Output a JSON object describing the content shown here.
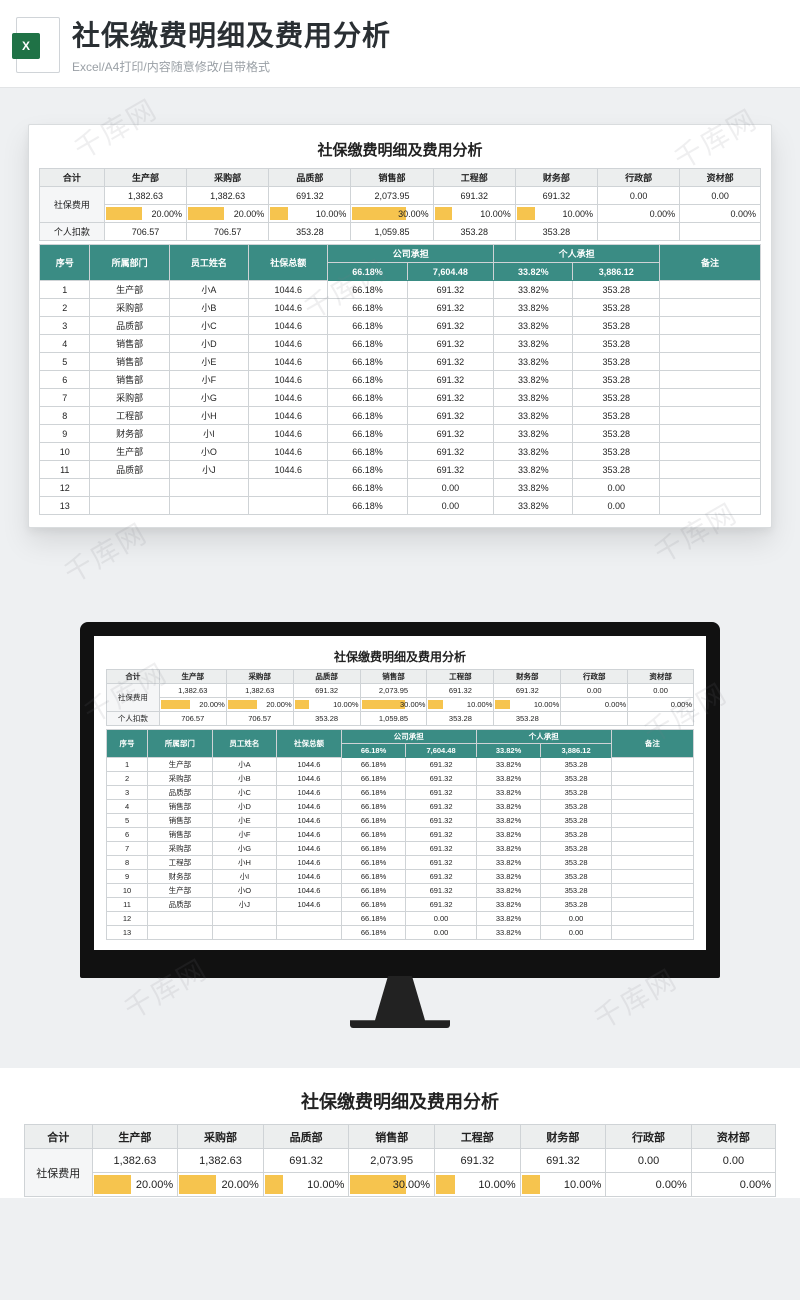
{
  "banner": {
    "title": "社保缴费明细及费用分析",
    "subtitle": "Excel/A4打印/内容随意修改/自带格式",
    "icon_label": "X",
    "icon_alt": "excel-icon"
  },
  "watermark_text": "千库网",
  "sheet_title": "社保缴费明细及费用分析",
  "summary": {
    "row_labels": {
      "total": "合计",
      "fee": "社保费用",
      "personal": "个人扣款"
    },
    "departments": [
      "生产部",
      "采购部",
      "品质部",
      "销售部",
      "工程部",
      "财务部",
      "行政部",
      "资材部"
    ],
    "fee_values": [
      "1,382.63",
      "1,382.63",
      "691.32",
      "2,073.95",
      "691.32",
      "691.32",
      "0.00",
      "0.00"
    ],
    "fee_pcts": [
      "20.00%",
      "20.00%",
      "10.00%",
      "30.00%",
      "10.00%",
      "10.00%",
      "0.00%",
      "0.00%"
    ],
    "fee_pcts_num": [
      20,
      20,
      10,
      30,
      10,
      10,
      0,
      0
    ],
    "personal_values": [
      "706.57",
      "706.57",
      "353.28",
      "1,059.85",
      "353.28",
      "353.28",
      "",
      ""
    ]
  },
  "detail": {
    "headers": {
      "seq": "序号",
      "dept": "所属部门",
      "name": "员工姓名",
      "total": "社保总额",
      "corp": "公司承担",
      "pers": "个人承担",
      "remark": "备注"
    },
    "sub_totals": {
      "corp_pct": "66.18%",
      "corp_amt": "7,604.48",
      "pers_pct": "33.82%",
      "pers_amt": "3,886.12"
    },
    "rows": [
      {
        "seq": "1",
        "dept": "生产部",
        "name": "小A",
        "total": "1044.6",
        "cp": "66.18%",
        "ca": "691.32",
        "pp": "33.82%",
        "pa": "353.28"
      },
      {
        "seq": "2",
        "dept": "采购部",
        "name": "小B",
        "total": "1044.6",
        "cp": "66.18%",
        "ca": "691.32",
        "pp": "33.82%",
        "pa": "353.28"
      },
      {
        "seq": "3",
        "dept": "品质部",
        "name": "小C",
        "total": "1044.6",
        "cp": "66.18%",
        "ca": "691.32",
        "pp": "33.82%",
        "pa": "353.28"
      },
      {
        "seq": "4",
        "dept": "销售部",
        "name": "小D",
        "total": "1044.6",
        "cp": "66.18%",
        "ca": "691.32",
        "pp": "33.82%",
        "pa": "353.28"
      },
      {
        "seq": "5",
        "dept": "销售部",
        "name": "小E",
        "total": "1044.6",
        "cp": "66.18%",
        "ca": "691.32",
        "pp": "33.82%",
        "pa": "353.28"
      },
      {
        "seq": "6",
        "dept": "销售部",
        "name": "小F",
        "total": "1044.6",
        "cp": "66.18%",
        "ca": "691.32",
        "pp": "33.82%",
        "pa": "353.28"
      },
      {
        "seq": "7",
        "dept": "采购部",
        "name": "小G",
        "total": "1044.6",
        "cp": "66.18%",
        "ca": "691.32",
        "pp": "33.82%",
        "pa": "353.28"
      },
      {
        "seq": "8",
        "dept": "工程部",
        "name": "小H",
        "total": "1044.6",
        "cp": "66.18%",
        "ca": "691.32",
        "pp": "33.82%",
        "pa": "353.28"
      },
      {
        "seq": "9",
        "dept": "财务部",
        "name": "小I",
        "total": "1044.6",
        "cp": "66.18%",
        "ca": "691.32",
        "pp": "33.82%",
        "pa": "353.28"
      },
      {
        "seq": "10",
        "dept": "生产部",
        "name": "小O",
        "total": "1044.6",
        "cp": "66.18%",
        "ca": "691.32",
        "pp": "33.82%",
        "pa": "353.28"
      },
      {
        "seq": "11",
        "dept": "品质部",
        "name": "小J",
        "total": "1044.6",
        "cp": "66.18%",
        "ca": "691.32",
        "pp": "33.82%",
        "pa": "353.28"
      },
      {
        "seq": "12",
        "dept": "",
        "name": "",
        "total": "",
        "cp": "66.18%",
        "ca": "0.00",
        "pp": "33.82%",
        "pa": "0.00"
      },
      {
        "seq": "13",
        "dept": "",
        "name": "",
        "total": "",
        "cp": "66.18%",
        "ca": "0.00",
        "pp": "33.82%",
        "pa": "0.00"
      }
    ]
  }
}
